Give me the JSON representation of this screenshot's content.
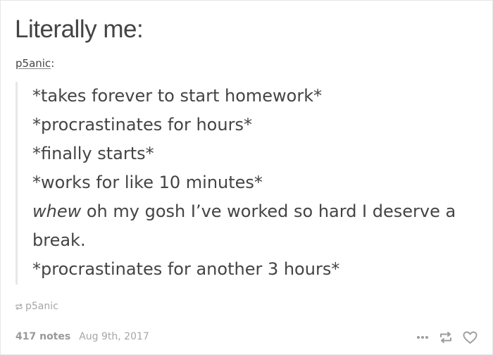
{
  "post": {
    "title": "Literally me:",
    "byline": {
      "author": "p5anic",
      "separator": ":"
    },
    "quote_lines": [
      "*takes forever to start homework*",
      "*procrastinates for hours*",
      "*finally starts*",
      "*works for like 10 minutes*"
    ],
    "emphasis_line": {
      "emphasis": "whew",
      "rest": " oh my gosh I’ve worked so hard I deserve a break."
    },
    "last_line": "*procrastinates for another 3 hours*",
    "source": {
      "label": "p5anic",
      "icon": "reblog-icon"
    },
    "footer": {
      "notes": "417 notes",
      "date": "Aug 9th, 2017"
    },
    "actions": [
      {
        "icon": "more-icon"
      },
      {
        "icon": "reblog-icon"
      },
      {
        "icon": "heart-icon"
      }
    ]
  }
}
